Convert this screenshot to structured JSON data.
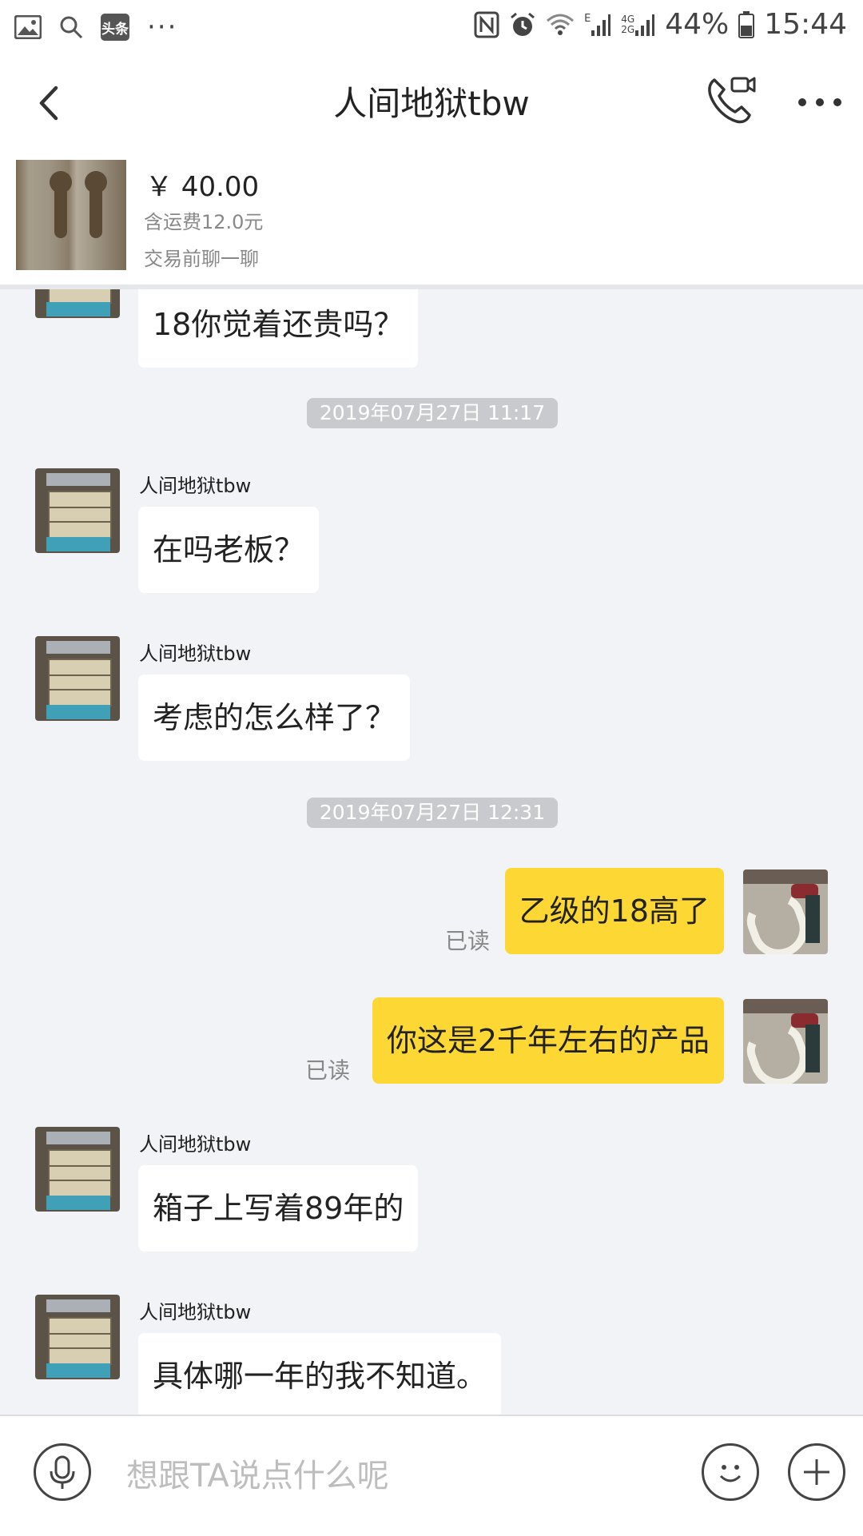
{
  "status_bar": {
    "battery": "44%",
    "time": "15:44",
    "app_badge": "头条",
    "more": "···",
    "network_top": "4G",
    "network_bottom": "2G",
    "network_e": "E"
  },
  "header": {
    "title": "人间地狱tbw"
  },
  "product": {
    "price": "￥ 40.00",
    "shipping": "含运费12.0元",
    "tagline": "交易前聊一聊"
  },
  "chat": {
    "partial_message": "18你觉着还贵吗？",
    "timestamps": [
      "2019年07月27日 11:17",
      "2019年07月27日 12:31"
    ],
    "sender_name": "人间地狱tbw",
    "messages_in_1": [
      "在吗老板？",
      "考虑的怎么样了？"
    ],
    "messages_out": [
      "乙级的18高了",
      "你这是2千年左右的产品"
    ],
    "read_label": "已读",
    "messages_in_2": [
      "箱子上写着89年的",
      "具体哪一年的我不知道。"
    ]
  },
  "input": {
    "placeholder": "想跟TA说点什么呢"
  },
  "colors": {
    "outgoing_bubble": "#fdd835",
    "background": "#f2f3f7",
    "timestamp_bg": "#c9cacd"
  }
}
